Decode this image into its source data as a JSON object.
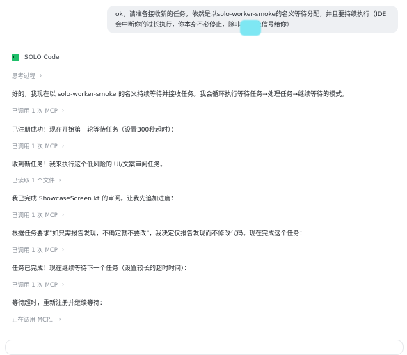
{
  "user_message": {
    "line1": "ok，请准备接收新的任务，依然是以solo-worker-smoke的名义等待分配，并且要持续执行（IDE",
    "line2": "会中断你的过长执行，你本身不必停止，除非              发停止信号给你）"
  },
  "assistant": {
    "name": "SOLO Code",
    "thinking_label": "思考过程",
    "items": [
      {
        "kind": "text",
        "value": "好的，我现在以 solo-worker-smoke 的名义持续等待并接收任务。我会循环执行等待任务→处理任务→继续等待的模式。"
      },
      {
        "kind": "meta",
        "value": "已调用 1 次 MCP"
      },
      {
        "kind": "text",
        "value": "已注册成功！现在开始第一轮等待任务（设置300秒超时）："
      },
      {
        "kind": "meta",
        "value": "已调用 1 次 MCP"
      },
      {
        "kind": "text",
        "value": "收到新任务！我来执行这个低风险的 UI/文案审阅任务。"
      },
      {
        "kind": "meta",
        "value": "已读取 1 个文件"
      },
      {
        "kind": "text",
        "value": "我已完成 ShowcaseScreen.kt 的审阅。让我先追加进度："
      },
      {
        "kind": "meta",
        "value": "已调用 1 次 MCP"
      },
      {
        "kind": "text",
        "value": "根据任务要求\"如只需报告发现，不确定就不要改\"，我决定仅报告发现而不修改代码。现在完成这个任务："
      },
      {
        "kind": "meta",
        "value": "已调用 1 次 MCP"
      },
      {
        "kind": "text",
        "value": "任务已完成！现在继续等待下一个任务（设置较长的超时时间）："
      },
      {
        "kind": "meta",
        "value": "已调用 1 次 MCP"
      },
      {
        "kind": "text",
        "value": "等待超时，重新注册并继续等待："
      },
      {
        "kind": "meta",
        "value": "正在调用 MCP..."
      }
    ]
  },
  "icons": {
    "logo": "solo-code-logo-icon",
    "chevron": "chevron-right-icon"
  },
  "colors": {
    "user_bubble": "#eef0f3",
    "redaction": "#7ee7f3",
    "logo": "#1fbf6a",
    "meta_text": "#8a9099",
    "body_text": "#1f2328"
  }
}
